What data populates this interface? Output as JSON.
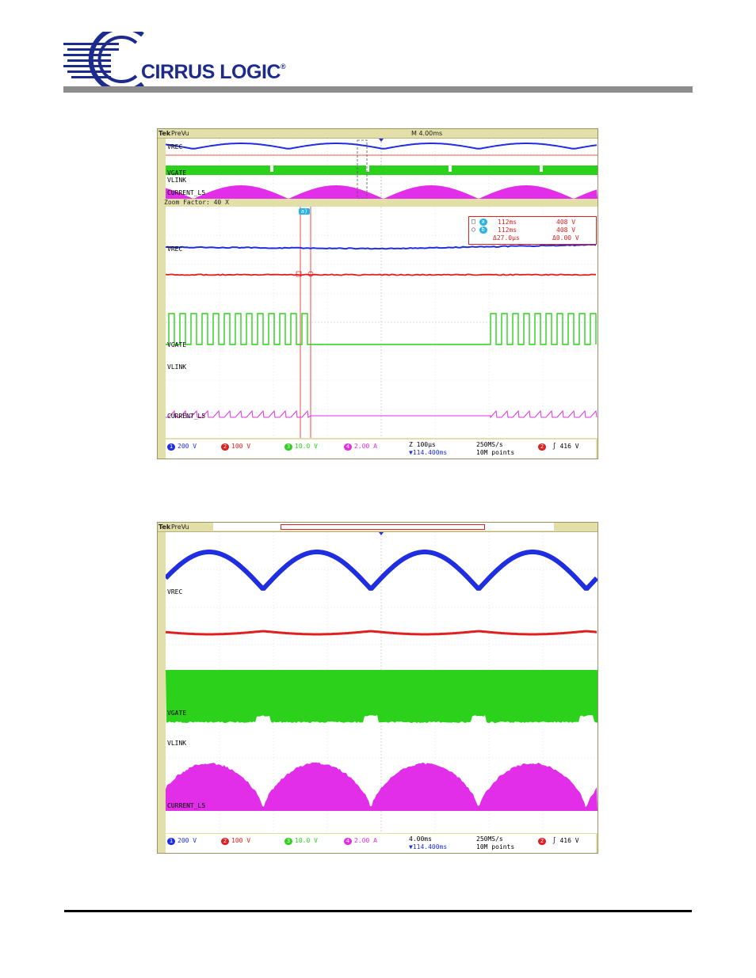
{
  "logo": {
    "brand": "CIRRUS LOGIC",
    "reg": "®"
  },
  "scope1": {
    "tek": "Tek",
    "mode": "PreVu",
    "timebase": "M 4.00ms",
    "zoom_factor": "Zoom Factor: 40 X",
    "cursor_marker": "a)",
    "channels": {
      "vrec": "VREC",
      "vgate": "VGATE",
      "vlink": "VLINK",
      "current": "CURRENT_L5"
    },
    "cursors": {
      "a_time": "112ms",
      "a_volt": "408 V",
      "b_time": "112ms",
      "b_volt": "408 V",
      "delta_time": "Δ27.0µs",
      "delta_volt": "Δ0.00 V"
    },
    "status": {
      "ch1": "200 V",
      "ch2": "100 V",
      "ch3": "10.0 V",
      "ch4": "2.00 A",
      "zoom": "Z 100µs",
      "pos": "▼114.400ms",
      "rate": "250MS/s",
      "points": "10M points",
      "trig_level": "416 V"
    }
  },
  "scope2": {
    "tek": "Tek",
    "mode": "PreVu",
    "channels": {
      "vrec": "VREC",
      "vgate": "VGATE",
      "vlink": "VLINK",
      "current": "CURRENT_L5"
    },
    "status": {
      "ch1": "200 V",
      "ch2": "100 V",
      "ch3": "10.0 V",
      "ch4": "2.00 A",
      "timebase": "4.00ms",
      "pos": "▼114.400ms",
      "rate": "250MS/s",
      "points": "10M points",
      "trig_level": "416 V"
    }
  },
  "colors": {
    "ch1": "#1e2ee0",
    "ch2": "#e0201e",
    "ch3": "#2bd11a",
    "ch4": "#e22ee8",
    "header": "#8d8d8d",
    "logo": "#1d2b8c"
  }
}
